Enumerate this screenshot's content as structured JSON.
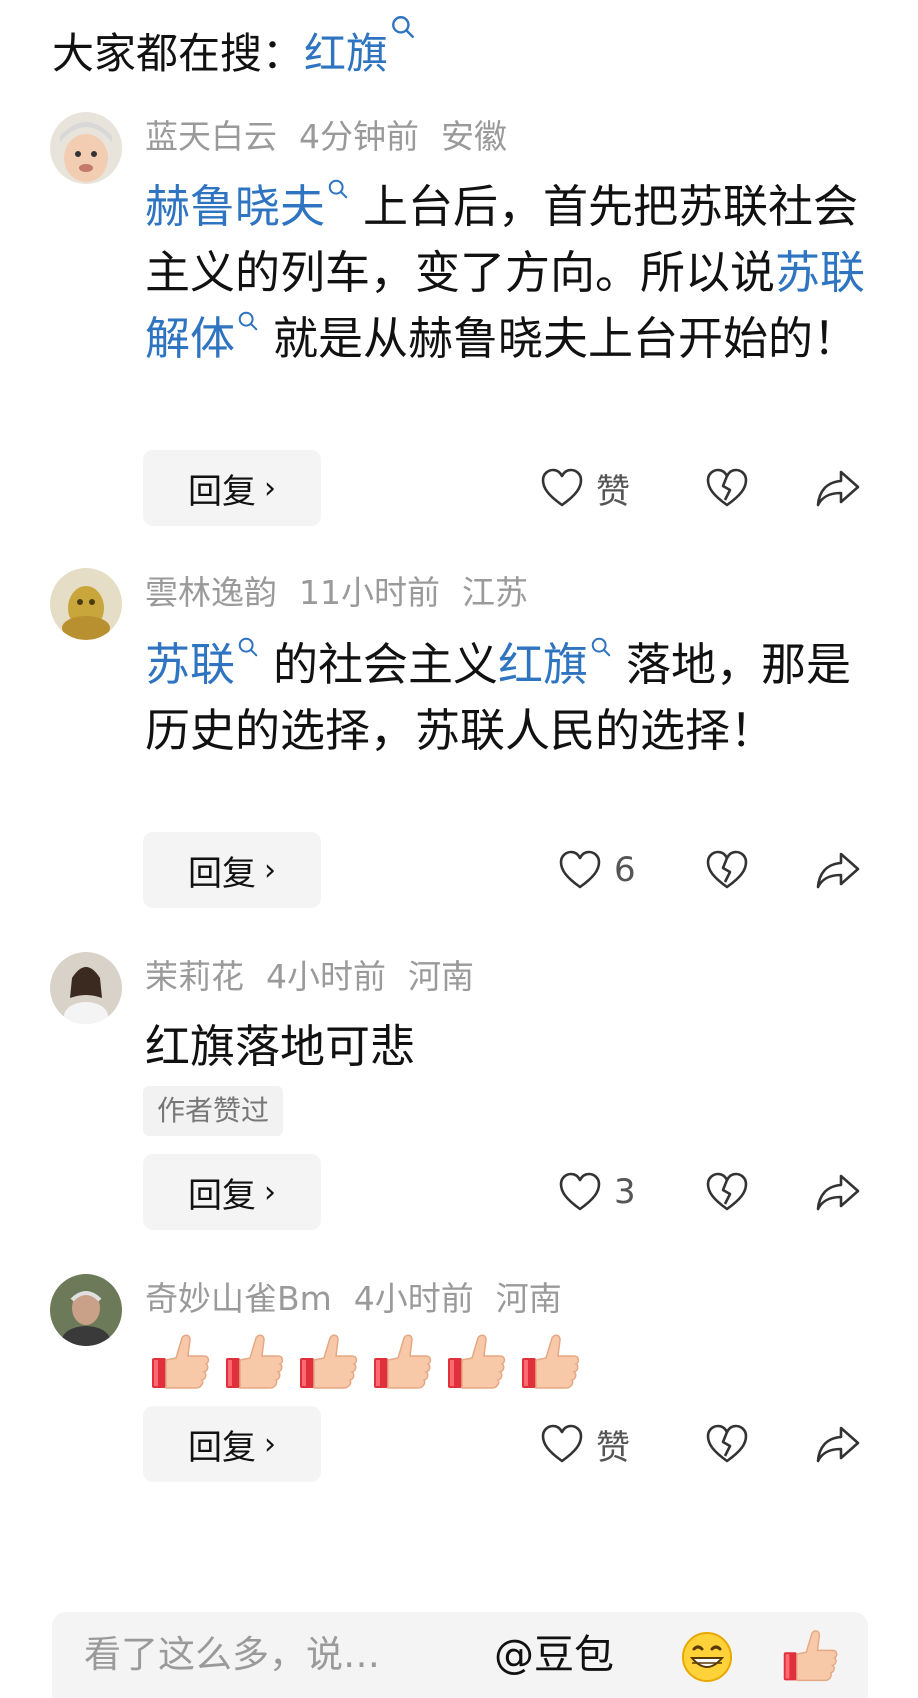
{
  "top_search": {
    "prefix": "大家都在搜：",
    "keyword": "红旗"
  },
  "comments": [
    {
      "user": "蓝天白云",
      "time": "4分钟前",
      "location": "安徽",
      "segments": [
        {
          "t": "赫鲁晓夫",
          "link": true
        },
        {
          "t": "上台后，首先把苏联社会主义的列车，变了方向。所以说",
          "link": false
        },
        {
          "t": "苏联解体",
          "link": true
        },
        {
          "t": "就是从赫鲁晓夫上台开始的！",
          "link": false
        }
      ],
      "reply_label": "回复",
      "like_label": "赞"
    },
    {
      "user": "雲林逸韵",
      "time": "11小时前",
      "location": "江苏",
      "segments": [
        {
          "t": "苏联",
          "link": true
        },
        {
          "t": "的社会主义",
          "link": false
        },
        {
          "t": "红旗",
          "link": true
        },
        {
          "t": "落地，那是历史的选择，苏联人民的选择！",
          "link": false
        }
      ],
      "reply_label": "回复",
      "like_label": "6"
    },
    {
      "user": "茉莉花",
      "time": "4小时前",
      "location": "河南",
      "text": "红旗落地可悲",
      "badge": "作者赞过",
      "reply_label": "回复",
      "like_label": "3"
    },
    {
      "user": "奇妙山雀Bm",
      "time": "4小时前",
      "location": "河南",
      "emoji_count": 6,
      "reply_label": "回复",
      "like_label": "赞"
    }
  ],
  "bottom_bar": {
    "placeholder": "看了这么多，说…",
    "at_label": "@豆包"
  },
  "colors": {
    "link": "#2f74c0",
    "meta": "#9a9a9a",
    "button_bg": "#f4f4f4"
  },
  "icons": [
    "search-icon",
    "heart-outline-icon",
    "broken-heart-icon",
    "share-arrow-icon",
    "chevron-right-icon",
    "grin-emoji-icon",
    "thumbs-up-emoji-icon"
  ]
}
